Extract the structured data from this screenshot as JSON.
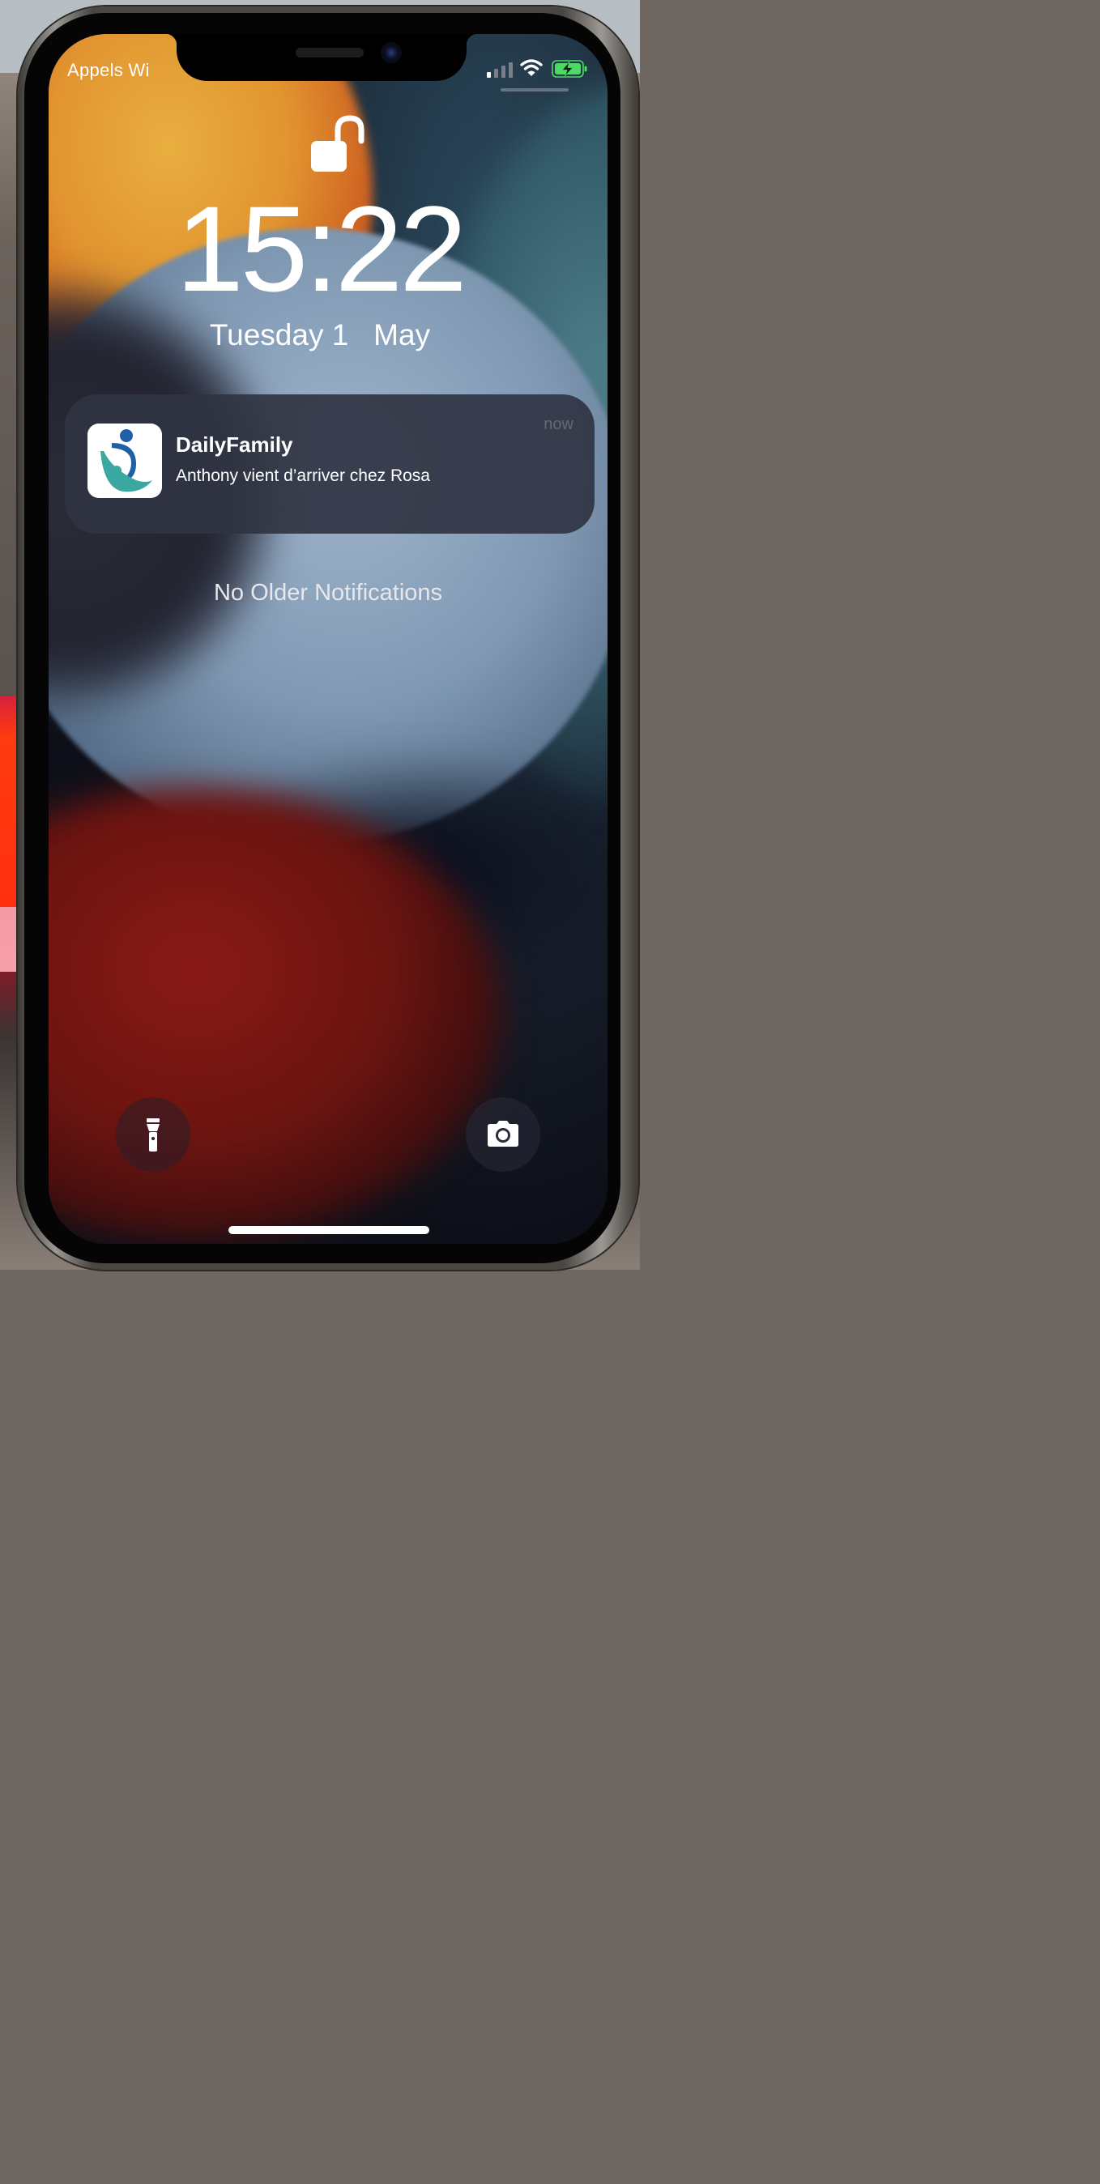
{
  "status_bar": {
    "carrier": "Appels Wi",
    "signal_bars_active": 1,
    "signal_bars_total": 4,
    "battery_charging": true,
    "battery_color": "#4cd964"
  },
  "lock_screen": {
    "lock_icon": "unlocked-padlock-icon",
    "time": "15:22",
    "date": "Tuesday 1   May"
  },
  "notification": {
    "app_name": "DailyFamily",
    "message": "Anthony vient d’arriver chez Rosa",
    "timestamp": "now",
    "icon": "dailyfamily-app-icon"
  },
  "list_footer": "No Older Notifications",
  "quick_actions": {
    "left": "flashlight-icon",
    "right": "camera-icon"
  },
  "colors": {
    "notification_bg": "#303442",
    "text": "#ffffff",
    "muted_text": "#626a78",
    "logo_blue": "#1f5fa8",
    "logo_teal": "#3aa8a0"
  }
}
